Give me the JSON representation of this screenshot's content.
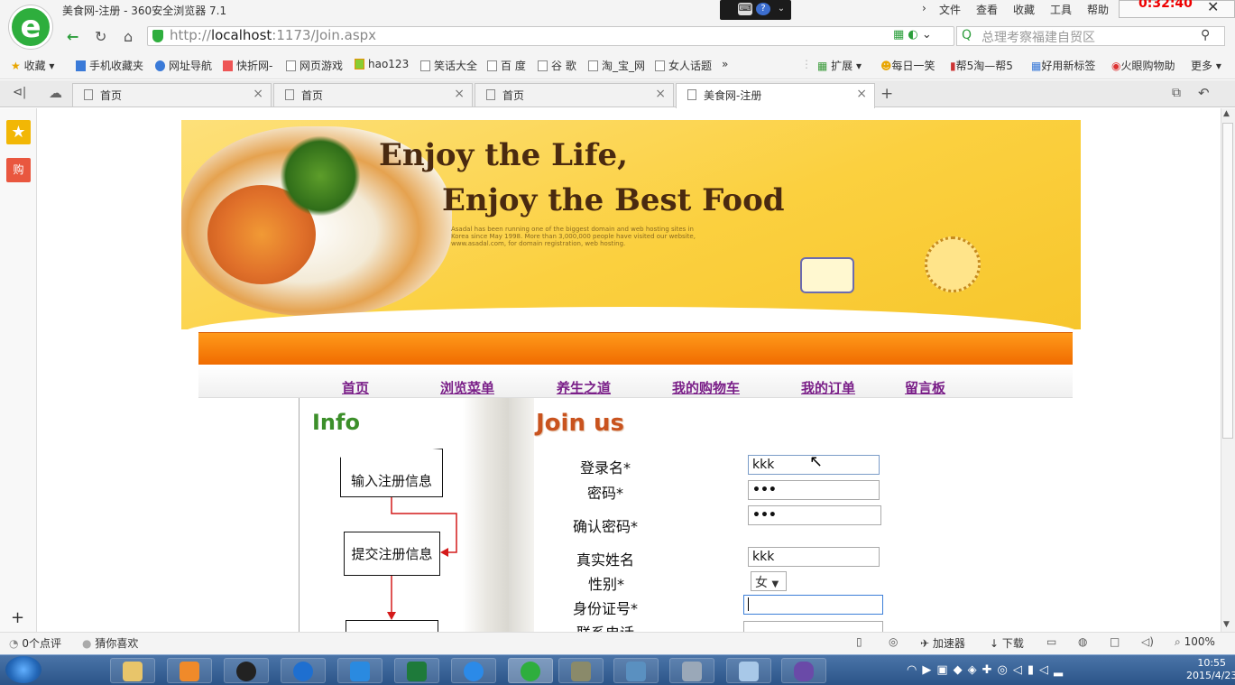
{
  "window": {
    "title": "美食网-注册 - 360安全浏览器 7.1",
    "menu": [
      "文件",
      "查看",
      "收藏",
      "工具",
      "帮助"
    ],
    "clock_overlay": "0:32:40"
  },
  "address": {
    "url_prefix": "http://",
    "url_host": "localhost",
    "url_rest": ":1173/Join.aspx",
    "search_placeholder": "总理考察福建自贸区"
  },
  "bookmarks": [
    "收藏",
    "手机收藏夹",
    "网址导航",
    "快折网-",
    "网页游戏",
    "hao123",
    "笑话大全",
    "百 度",
    "谷 歌",
    "淘_宝_网",
    "女人话题",
    "»"
  ],
  "bookmarks_right": [
    "扩展",
    "每日一笑",
    "帮5淘—帮5",
    "好用新标签",
    "火眼购物助",
    "更多"
  ],
  "tabs": [
    {
      "label": "首页"
    },
    {
      "label": "首页"
    },
    {
      "label": "首页"
    },
    {
      "label": "美食网-注册"
    }
  ],
  "banner": {
    "line1": "Enjoy the Life,",
    "line2": "Enjoy the Best Food",
    "small": "Asadal has been running one of the biggest domain and web hosting sites in Korea since May 1998. More than 3,000,000 people have visited our website, www.asadal.com, for domain registration, web hosting."
  },
  "nav": [
    "首页",
    "浏览菜单",
    "养生之道",
    "我的购物车",
    "我的订单",
    "留言板"
  ],
  "info": {
    "title": "Info",
    "flow": [
      "输入注册信息",
      "提交注册信息"
    ]
  },
  "join": {
    "title": "Join us",
    "labels": {
      "login": "登录名*",
      "password": "密码*",
      "confirm": "确认密码*",
      "realname": "真实姓名",
      "sex": "性别*",
      "idcard": "身份证号*",
      "phone": "联系电话"
    },
    "values": {
      "login": "kkk",
      "password": "•••",
      "confirm": "•••",
      "realname": "kkk",
      "sex": "女",
      "idcard": ""
    }
  },
  "statusbar": {
    "comments": "0个点评",
    "guess": "猜你喜欢",
    "accelerator": "加速器",
    "download": "下载",
    "zoom": "100%"
  },
  "taskbar": {
    "time": "10:55",
    "date": "2015/4/23"
  }
}
